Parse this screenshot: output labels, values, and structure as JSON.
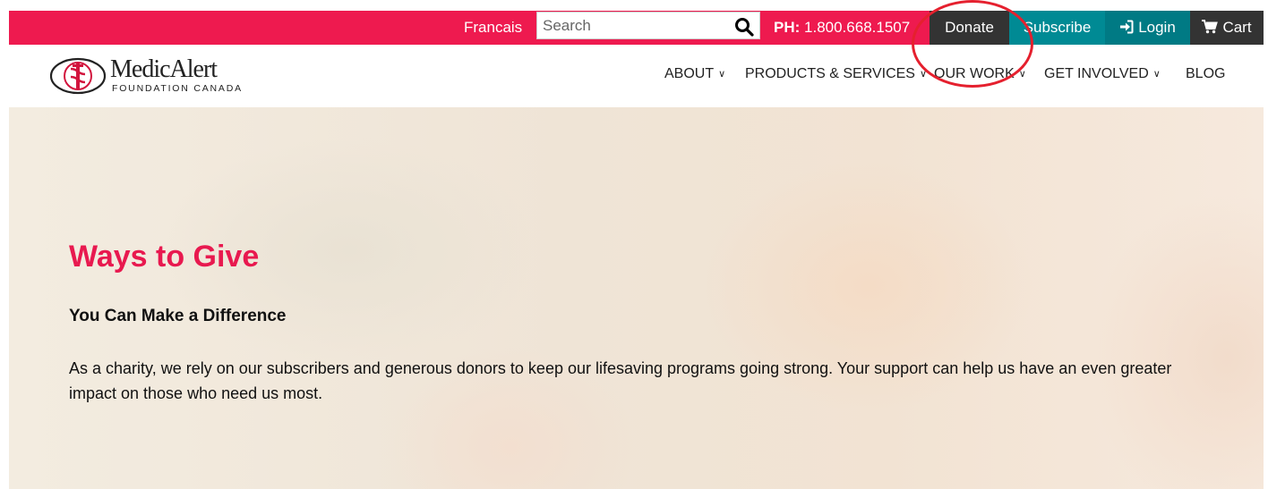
{
  "topbar": {
    "language_link": "Francais",
    "search_placeholder": "Search",
    "phone_label": "PH:",
    "phone_number": "1.800.668.1507",
    "donate_label": "Donate",
    "subscribe_label": "Subscribe",
    "login_label": "Login",
    "cart_label": "Cart"
  },
  "logo": {
    "brand": "MedicAlert",
    "subtitle": "FOUNDATION CANADA"
  },
  "nav": {
    "items": [
      {
        "label": "ABOUT",
        "has_dropdown": true
      },
      {
        "label": "PRODUCTS & SERVICES",
        "has_dropdown": true
      },
      {
        "label": "OUR WORK",
        "has_dropdown": true
      },
      {
        "label": "GET INVOLVED",
        "has_dropdown": true
      },
      {
        "label": "BLOG",
        "has_dropdown": false
      }
    ]
  },
  "hero": {
    "title": "Ways to Give",
    "subtitle": "You Can Make a Difference",
    "body": "As a charity, we rely on our subscribers and generous donors to keep our lifesaving programs going strong. Your support can help us have an even greater impact on those who need us most."
  },
  "colors": {
    "brand_pink": "#ee1a4f",
    "teal": "#008a94",
    "dark": "#333333",
    "annotation_red": "#e5202e"
  },
  "icons": [
    "search-icon",
    "login-icon",
    "cart-icon",
    "chevron-down-icon",
    "medicalert-emblem-icon"
  ]
}
